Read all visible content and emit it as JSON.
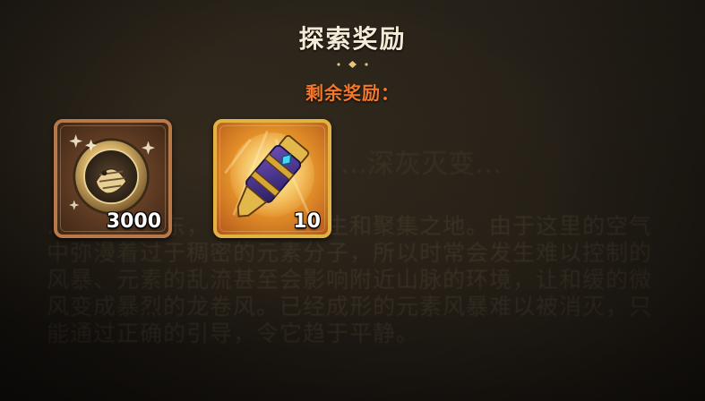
{
  "header": {
    "title": "探索奖励"
  },
  "rewards_section": {
    "label": "剩余奖励："
  },
  "rewards": [
    {
      "icon": "medallion-coin-icon",
      "quantity": "3000",
      "frame": "bronze"
    },
    {
      "icon": "gauntlet-icon",
      "quantity": "10",
      "frame": "gold"
    }
  ],
  "background": {
    "heading": "…深灰灭变…",
    "lore": "…于……之东，…是元素诞生和聚集之地。由于这里的空气中弥漫着过于稠密的元素分子，所以时常会发生难以控制的风暴、元素的乱流甚至会影响附近山脉的环境，让和缓的微风变成暴烈的龙卷风。已经成形的元素风暴难以被消灭，只能通过正确的引导，令它趋于平静。"
  },
  "colors": {
    "title": "#f4ead6",
    "subtitle": "#f2782b",
    "divider": "#c9a366",
    "bronze_frame": "#b7794a",
    "gold_frame": "#e3b341"
  }
}
